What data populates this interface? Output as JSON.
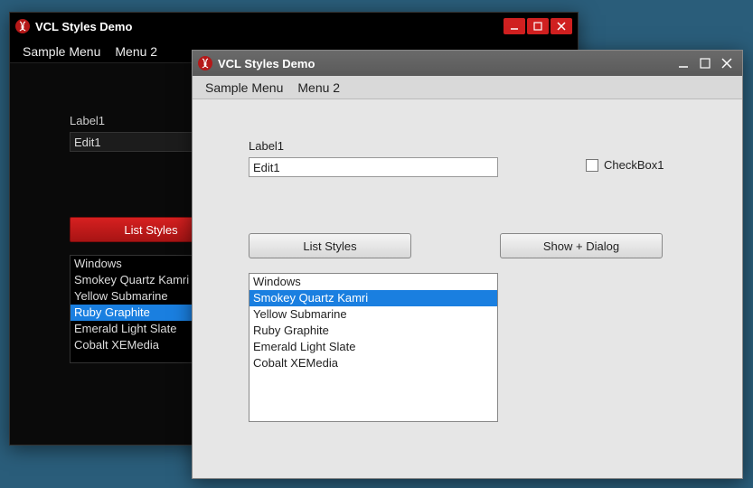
{
  "windows": {
    "dark": {
      "title": "VCL Styles Demo",
      "menu": {
        "items": [
          "Sample Menu",
          "Menu 2"
        ]
      },
      "label1": "Label1",
      "edit1_value": "Edit1",
      "buttons": {
        "list_styles": "List Styles"
      },
      "listbox": {
        "items": [
          "Windows",
          "Smokey Quartz Kamri",
          "Yellow Submarine",
          "Ruby Graphite",
          "Emerald Light Slate",
          "Cobalt XEMedia"
        ],
        "selected": "Ruby Graphite"
      }
    },
    "light": {
      "title": "VCL Styles Demo",
      "menu": {
        "items": [
          "Sample Menu",
          "Menu 2"
        ]
      },
      "label1": "Label1",
      "edit1_value": "Edit1",
      "checkbox1": {
        "label": "CheckBox1",
        "checked": false
      },
      "buttons": {
        "list_styles": "List Styles",
        "show_dialog": "Show + Dialog"
      },
      "listbox": {
        "items": [
          "Windows",
          "Smokey Quartz Kamri",
          "Yellow Submarine",
          "Ruby Graphite",
          "Emerald Light Slate",
          "Cobalt XEMedia"
        ],
        "selected": "Smokey Quartz Kamri"
      }
    }
  }
}
